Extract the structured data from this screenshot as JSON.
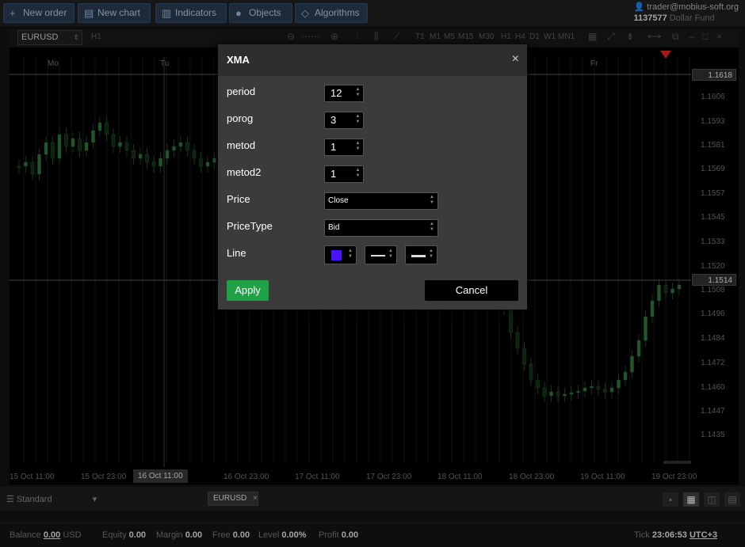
{
  "toolbar": {
    "new_order": "New order",
    "new_chart": "New chart",
    "indicators": "Indicators",
    "objects": "Objects",
    "algorithms": "Algorithms"
  },
  "account": {
    "email": "trader@mobius-soft.org",
    "id": "1137577",
    "name": "Dollar Fund"
  },
  "chart_toolbar": {
    "symbol": "EURUSD",
    "period": "H1",
    "timeframes": [
      "T1",
      "M1",
      "M5",
      "M15",
      "M30",
      "H1",
      "H4",
      "D1",
      "W1",
      "MN1"
    ]
  },
  "chart": {
    "price_labels": [
      "1.1606",
      "1.1593",
      "1.1581",
      "1.1569",
      "1.1557",
      "1.1545",
      "1.1533",
      "1.1520",
      "1.1508",
      "1.1496",
      "1.1484",
      "1.1472",
      "1.1460",
      "1.1447",
      "1.1435"
    ],
    "price_tag_top": "1.1618",
    "price_tag_current": "1.1514",
    "day_labels": [
      "Mo",
      "Tu",
      "Fr"
    ],
    "time_labels": [
      "15 Oct 11:00",
      "15 Oct 23:00",
      "16 Oct 23:00",
      "17 Oct 11:00",
      "17 Oct 23:00",
      "18 Oct 11:00",
      "18 Oct 23:00",
      "19 Oct 11:00",
      "19 Oct 23:00"
    ],
    "time_cursor": "16 Oct 11:00"
  },
  "dialog": {
    "title": "XMA",
    "close_glyph": "×",
    "fields": {
      "period": {
        "label": "period",
        "value": "12"
      },
      "porog": {
        "label": "porog",
        "value": "3"
      },
      "metod": {
        "label": "metod",
        "value": "1"
      },
      "metod2": {
        "label": "metod2",
        "value": "1"
      },
      "price": {
        "label": "Price",
        "value": "Close"
      },
      "pricetype": {
        "label": "PriceType",
        "value": "Bid"
      },
      "line": {
        "label": "Line",
        "color": "#4a14ff"
      }
    },
    "apply_label": "Apply",
    "cancel_label": "Cancel"
  },
  "bottom": {
    "layout_name": "Standard",
    "symbol_tab": "EURUSD"
  },
  "status": {
    "balance_label": "Balance",
    "balance_value": "0.00",
    "balance_currency": "USD",
    "equity_label": "Equity",
    "equity_value": "0.00",
    "margin_label": "Margin",
    "margin_value": "0.00",
    "free_label": "Free",
    "free_value": "0.00",
    "level_label": "Level",
    "level_value": "0.00%",
    "profit_label": "Profit",
    "profit_value": "0.00",
    "tick_label": "Tick",
    "tick_value": "23:06:53",
    "timezone": "UTC+3"
  },
  "colors": {
    "apply_green": "#1fa246",
    "toolbar_blue": "#243447",
    "candle_green": "#1e5a2a",
    "sell_arrow": "#c81e1e"
  }
}
